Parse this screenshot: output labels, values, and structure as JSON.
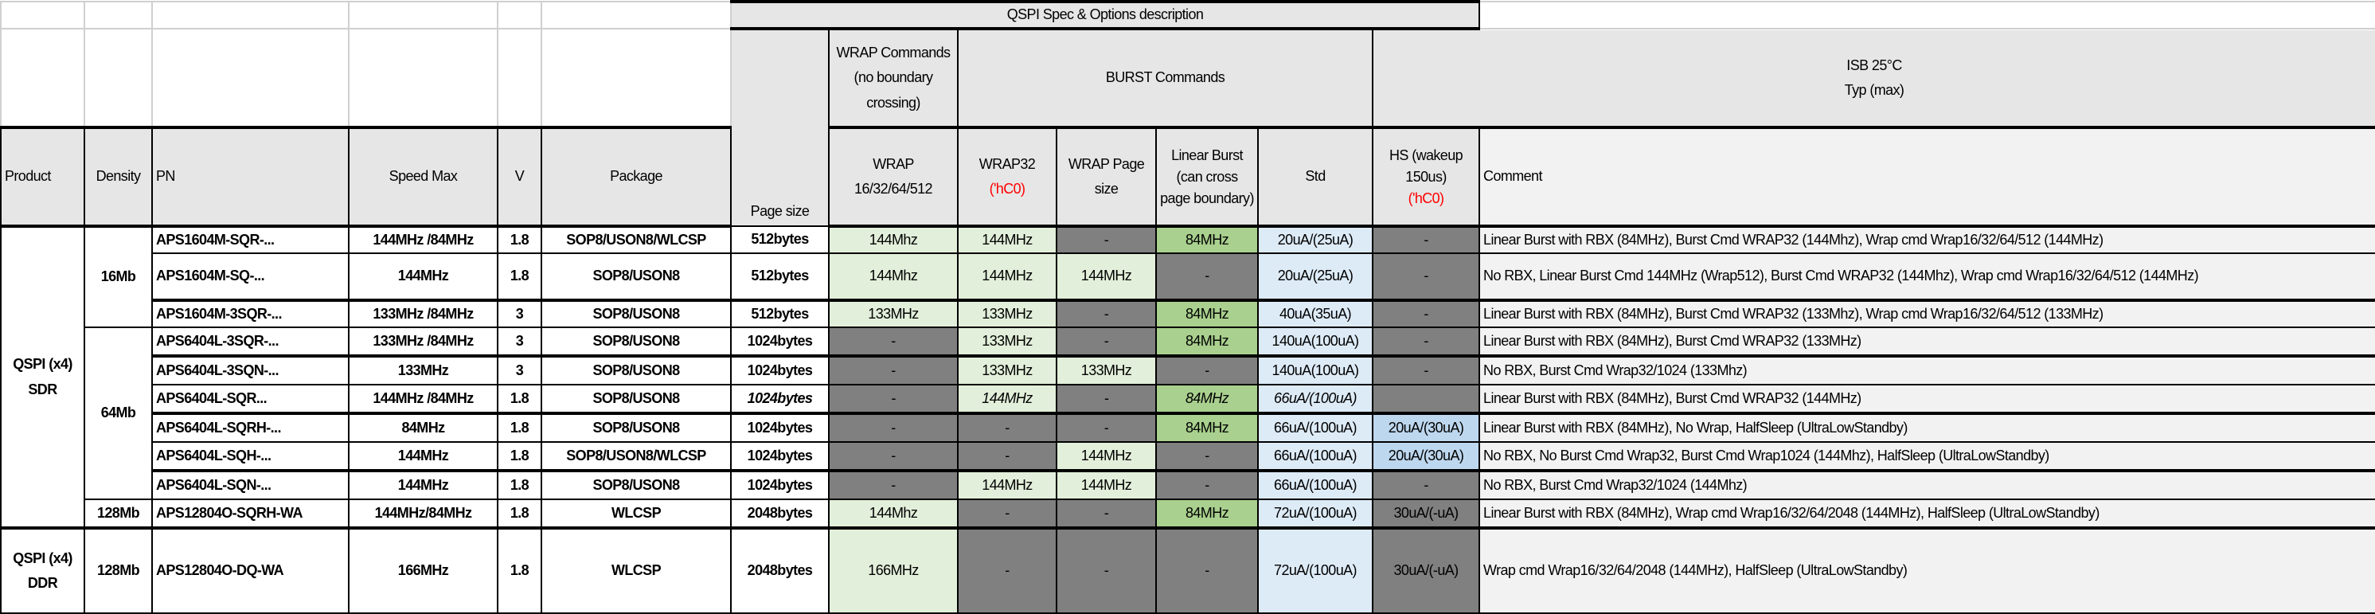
{
  "header": {
    "spec_title": "QSPI Spec & Options description",
    "wrap_group": "WRAP Commands (no boundary crossing)",
    "burst_group": "BURST Commands",
    "isb_group_line1": "ISB 25°C",
    "isb_group_line2": "Typ (max)",
    "product": "Product",
    "density": "Density",
    "pn": "PN",
    "speed": "Speed Max",
    "v": "V",
    "package": "Package",
    "page_size": "Page size",
    "wrap_col": "WRAP 16/32/64/512",
    "wrap32": "WRAP32",
    "wrap32_note": "('hC0)",
    "wrap_page": "WRAP Page size",
    "linear": "Linear Burst (can cross page boundary)",
    "std": "Std",
    "hs": "HS (wakeup 150us)",
    "hs_note": "('hC0)",
    "comment": "Comment"
  },
  "products": [
    {
      "label": "QSPI (x4) SDR",
      "densities": [
        {
          "label": "16Mb",
          "rows": 3
        },
        {
          "label": "64Mb",
          "rows": 6
        },
        {
          "label": "128Mb",
          "rows": 1
        }
      ]
    },
    {
      "label": "QSPI (x4) DDR",
      "densities": [
        {
          "label": "128Mb",
          "rows": 1
        }
      ]
    }
  ],
  "colors": {
    "light_green": "#e2efda",
    "green": "#a9d08e",
    "dark_gray": "#808080",
    "light_blue": "#ddebf7",
    "hs_blue": "#bdd7ee",
    "header_gray": "#e6e6e6"
  },
  "rows": [
    {
      "pn": "APS1604M-SQR-...",
      "speed": "144MHz /84MHz",
      "v": "1.8",
      "pkg": "SOP8/USON8/WLCSP",
      "page": "512bytes",
      "wrap": {
        "text": "144Mhz",
        "fill": "lg"
      },
      "wrap32": {
        "text": "144MHz",
        "fill": "lg"
      },
      "wrap_page": {
        "text": "-",
        "fill": "d"
      },
      "linear": {
        "text": "84MHz",
        "fill": "g"
      },
      "std": {
        "text": "20uA/(25uA)",
        "fill": "b"
      },
      "hs": {
        "text": "-",
        "fill": "d"
      },
      "comment": "Linear Burst with RBX (84MHz), Burst Cmd WRAP32 (144Mhz), Wrap cmd Wrap16/32/64/512 (144MHz)"
    },
    {
      "pn": "APS1604M-SQ-...",
      "speed": "144MHz",
      "v": "1.8",
      "pkg": "SOP8/USON8",
      "page": "512bytes",
      "wrap": {
        "text": "144Mhz",
        "fill": "lg"
      },
      "wrap32": {
        "text": "144MHz",
        "fill": "lg"
      },
      "wrap_page": {
        "text": "144MHz",
        "fill": "lg"
      },
      "linear": {
        "text": "-",
        "fill": "d"
      },
      "std": {
        "text": "20uA/(25uA)",
        "fill": "b"
      },
      "hs": {
        "text": "-",
        "fill": "d"
      },
      "comment": "No RBX, Linear Burst Cmd 144MHz (Wrap512), Burst Cmd WRAP32 (144Mhz), Wrap cmd Wrap16/32/64/512 (144MHz)"
    },
    {
      "pn": "APS1604M-3SQR-...",
      "speed": "133MHz /84MHz",
      "v": "3",
      "pkg": "SOP8/USON8",
      "page": "512bytes",
      "wrap": {
        "text": "133MHz",
        "fill": "lg"
      },
      "wrap32": {
        "text": "133MHz",
        "fill": "lg"
      },
      "wrap_page": {
        "text": "-",
        "fill": "d"
      },
      "linear": {
        "text": "84MHz",
        "fill": "g"
      },
      "std": {
        "text": "40uA(35uA)",
        "fill": "b"
      },
      "hs": {
        "text": "-",
        "fill": "d"
      },
      "comment": "Linear Burst with RBX (84MHz), Burst Cmd WRAP32 (133Mhz), Wrap cmd Wrap16/32/64/512 (133MHz)"
    },
    {
      "pn": "APS6404L-3SQR-...",
      "speed": "133MHz /84MHz",
      "v": "3",
      "pkg": "SOP8/USON8",
      "page": "1024bytes",
      "wrap": {
        "text": "-",
        "fill": "d"
      },
      "wrap32": {
        "text": "133MHz",
        "fill": "lg"
      },
      "wrap_page": {
        "text": "-",
        "fill": "d"
      },
      "linear": {
        "text": "84MHz",
        "fill": "g"
      },
      "std": {
        "text": "140uA(100uA)",
        "fill": "b"
      },
      "hs": {
        "text": "-",
        "fill": "d"
      },
      "comment": "Linear Burst with RBX (84MHz), Burst Cmd WRAP32 (133MHz)"
    },
    {
      "pn": "APS6404L-3SQN-...",
      "speed": "133MHz",
      "v": "3",
      "pkg": "SOP8/USON8",
      "page": "1024bytes",
      "wrap": {
        "text": "-",
        "fill": "d"
      },
      "wrap32": {
        "text": "133MHz",
        "fill": "lg"
      },
      "wrap_page": {
        "text": "133MHz",
        "fill": "lg"
      },
      "linear": {
        "text": "-",
        "fill": "d"
      },
      "std": {
        "text": "140uA(100uA)",
        "fill": "b"
      },
      "hs": {
        "text": "-",
        "fill": "d"
      },
      "comment": "No RBX, Burst Cmd Wrap32/1024 (133Mhz)"
    },
    {
      "pn": "APS6404L-SQR...",
      "speed": "144MHz /84MHz",
      "v": "1.8",
      "pkg": "SOP8/USON8",
      "page": "1024bytes",
      "italic": true,
      "wrap": {
        "text": "-",
        "fill": "d"
      },
      "wrap32": {
        "text": "144MHz",
        "fill": "lg"
      },
      "wrap_page": {
        "text": "-",
        "fill": "d"
      },
      "linear": {
        "text": "84MHz",
        "fill": "g"
      },
      "std": {
        "text": "66uA/(100uA)",
        "fill": "b"
      },
      "hs": {
        "text": "",
        "fill": "d"
      },
      "comment": "Linear Burst with RBX (84MHz), Burst Cmd WRAP32 (144MHz)"
    },
    {
      "pn": "APS6404L-SQRH-...",
      "speed": "84MHz",
      "v": "1.8",
      "pkg": "SOP8/USON8",
      "page": "1024bytes",
      "wrap": {
        "text": "-",
        "fill": "d"
      },
      "wrap32": {
        "text": "-",
        "fill": "d"
      },
      "wrap_page": {
        "text": "-",
        "fill": "d"
      },
      "linear": {
        "text": "84MHz",
        "fill": "g"
      },
      "std": {
        "text": "66uA/(100uA)",
        "fill": "b"
      },
      "hs": {
        "text": "20uA/(30uA)",
        "fill": "hb"
      },
      "comment": "Linear Burst with RBX (84MHz), No Wrap, HalfSleep (UltraLowStandby)"
    },
    {
      "pn": "APS6404L-SQH-...",
      "speed": "144MHz",
      "v": "1.8",
      "pkg": "SOP8/USON8/WLCSP",
      "page": "1024bytes",
      "wrap": {
        "text": "-",
        "fill": "d"
      },
      "wrap32": {
        "text": "-",
        "fill": "d"
      },
      "wrap_page": {
        "text": "144MHz",
        "fill": "lg"
      },
      "linear": {
        "text": "-",
        "fill": "d"
      },
      "std": {
        "text": "66uA/(100uA)",
        "fill": "b"
      },
      "hs": {
        "text": "20uA/(30uA)",
        "fill": "hb"
      },
      "comment": "No RBX, No Burst Cmd Wrap32, Burst Cmd Wrap1024 (144Mhz), HalfSleep (UltraLowStandby)"
    },
    {
      "pn": "APS6404L-SQN-...",
      "speed": "144MHz",
      "v": "1.8",
      "pkg": "SOP8/USON8",
      "page": "1024bytes",
      "wrap": {
        "text": "-",
        "fill": "d"
      },
      "wrap32": {
        "text": "144MHz",
        "fill": "lg"
      },
      "wrap_page": {
        "text": "144MHz",
        "fill": "lg"
      },
      "linear": {
        "text": "-",
        "fill": "d"
      },
      "std": {
        "text": "66uA/(100uA)",
        "fill": "b"
      },
      "hs": {
        "text": "-",
        "fill": "d"
      },
      "comment": "No RBX, Burst Cmd Wrap32/1024 (144Mhz)"
    },
    {
      "pn": "APS12804O-SQRH-WA",
      "speed": "144MHz/84MHz",
      "v": "1.8",
      "pkg": "WLCSP",
      "page": "2048bytes",
      "wrap": {
        "text": "144Mhz",
        "fill": "lg"
      },
      "wrap32": {
        "text": "-",
        "fill": "d"
      },
      "wrap_page": {
        "text": "-",
        "fill": "d"
      },
      "linear": {
        "text": "84MHz",
        "fill": "g"
      },
      "std": {
        "text": "72uA/(100uA)",
        "fill": "b"
      },
      "hs": {
        "text": "30uA/(-uA)",
        "fill": "d"
      },
      "comment": "Linear Burst with RBX (84MHz), Wrap cmd Wrap16/32/64/2048 (144MHz), HalfSleep (UltraLowStandby)"
    },
    {
      "pn": "APS12804O-DQ-WA",
      "speed": "166MHz",
      "v": "1.8",
      "pkg": "WLCSP",
      "page": "2048bytes",
      "wrap": {
        "text": "166MHz",
        "fill": "lg"
      },
      "wrap32": {
        "text": "-",
        "fill": "d"
      },
      "wrap_page": {
        "text": "-",
        "fill": "d"
      },
      "linear": {
        "text": "-",
        "fill": "d"
      },
      "std": {
        "text": "72uA/(100uA)",
        "fill": "b"
      },
      "hs": {
        "text": "30uA/(-uA)",
        "fill": "d"
      },
      "comment": "Wrap cmd Wrap16/32/64/2048 (144MHz), HalfSleep (UltraLowStandby)"
    }
  ]
}
